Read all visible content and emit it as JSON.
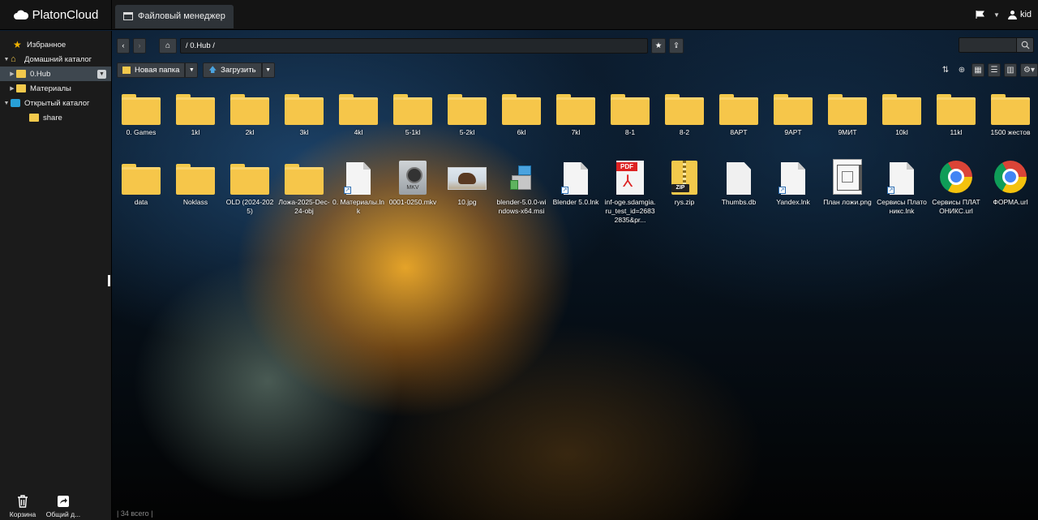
{
  "app": {
    "brand": "PlatonCloud",
    "tab_title": "Файловый менеджер",
    "user_name": "kid"
  },
  "sidebar": {
    "items": [
      {
        "label": "Избранное"
      },
      {
        "label": "Домашний каталог"
      },
      {
        "label": "0.Hub"
      },
      {
        "label": "Материалы"
      },
      {
        "label": "Открытый каталог"
      },
      {
        "label": "share"
      }
    ],
    "bottom": [
      {
        "label": "Корзина"
      },
      {
        "label": "Общий д..."
      }
    ]
  },
  "path": {
    "value": "/ 0.Hub /"
  },
  "toolbar": {
    "new_folder": "Новая папка",
    "upload": "Загрузить"
  },
  "files": [
    {
      "name": "0. Games",
      "type": "folder"
    },
    {
      "name": "1kl",
      "type": "folder"
    },
    {
      "name": "2kl",
      "type": "folder"
    },
    {
      "name": "3kl",
      "type": "folder"
    },
    {
      "name": "4kl",
      "type": "folder"
    },
    {
      "name": "5-1kl",
      "type": "folder"
    },
    {
      "name": "5-2kl",
      "type": "folder"
    },
    {
      "name": "6kl",
      "type": "folder"
    },
    {
      "name": "7kl",
      "type": "folder"
    },
    {
      "name": "8-1",
      "type": "folder"
    },
    {
      "name": "8-2",
      "type": "folder"
    },
    {
      "name": "8APT",
      "type": "folder"
    },
    {
      "name": "9APT",
      "type": "folder"
    },
    {
      "name": "9МИТ",
      "type": "folder"
    },
    {
      "name": "10kl",
      "type": "folder"
    },
    {
      "name": "11kl",
      "type": "folder"
    },
    {
      "name": "1500 жестов",
      "type": "folder"
    },
    {
      "name": "data",
      "type": "folder"
    },
    {
      "name": "Noklass",
      "type": "folder"
    },
    {
      "name": "OLD (2024-2025)",
      "type": "folder"
    },
    {
      "name": "Ложа-2025-Dec-24-obj",
      "type": "folder"
    },
    {
      "name": "0. Материалы.lnk",
      "type": "lnk"
    },
    {
      "name": "0001-0250.mkv",
      "type": "mkv"
    },
    {
      "name": "10.jpg",
      "type": "jpg"
    },
    {
      "name": "blender-5.0.0-windows-x64.msi",
      "type": "msi"
    },
    {
      "name": "Blender 5.0.lnk",
      "type": "lnk"
    },
    {
      "name": "inf-oge.sdamgia.ru_test_id=26832835&pr...",
      "type": "pdf"
    },
    {
      "name": "rys.zip",
      "type": "zip"
    },
    {
      "name": "Thumbs.db",
      "type": "db"
    },
    {
      "name": "Yandex.lnk",
      "type": "lnk"
    },
    {
      "name": "План ложи.png",
      "type": "png"
    },
    {
      "name": "Сервисы Платоникс.lnk",
      "type": "lnk"
    },
    {
      "name": "Сервисы ПЛАТОНИКС.url",
      "type": "url"
    },
    {
      "name": "ФОРМА.url",
      "type": "url"
    }
  ],
  "status": {
    "total": "| 34 всего |"
  },
  "icons": {
    "back": "chevron-left-icon",
    "forward": "chevron-right-icon",
    "home": "home-icon",
    "bookmark": "star-icon",
    "up": "upload-arrow-icon",
    "search": "search-icon"
  }
}
